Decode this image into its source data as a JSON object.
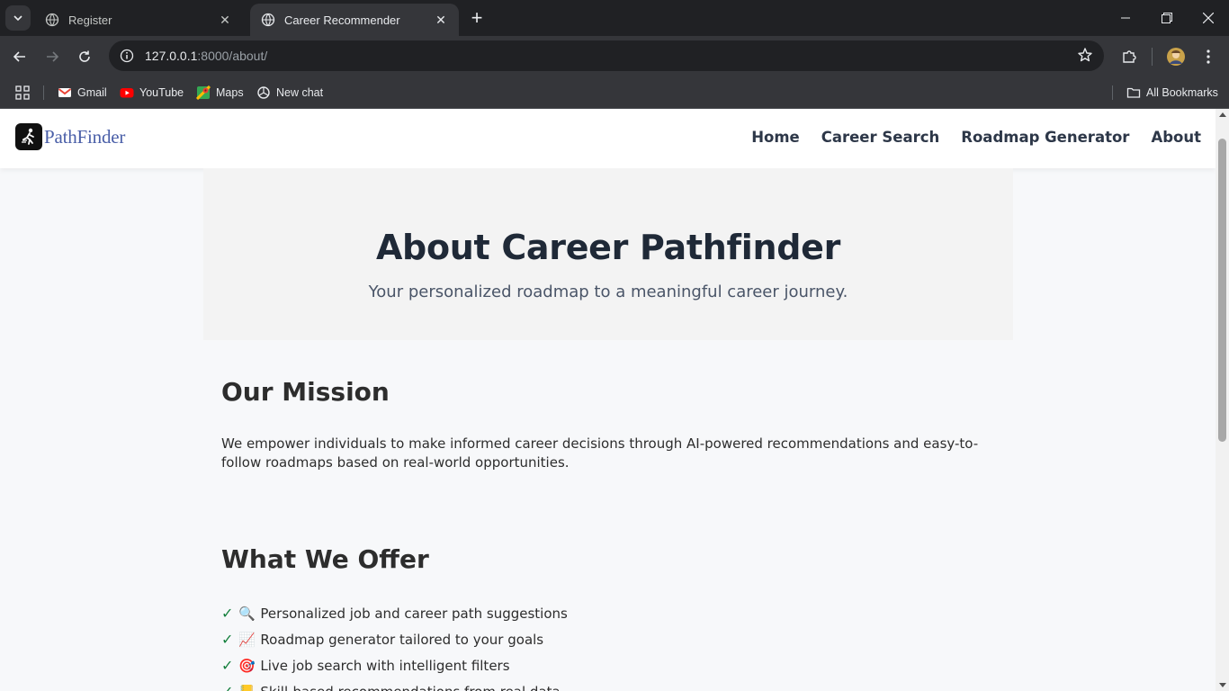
{
  "browser": {
    "tabs": [
      {
        "title": "Register",
        "active": false
      },
      {
        "title": "Career Recommender",
        "active": true
      }
    ],
    "url_host": "127.0.0.1",
    "url_path": ":8000/about/",
    "bookmarks": [
      {
        "label": "Gmail",
        "icon": "gmail-icon"
      },
      {
        "label": "YouTube",
        "icon": "youtube-icon"
      },
      {
        "label": "Maps",
        "icon": "maps-icon"
      },
      {
        "label": "New chat",
        "icon": "chatgpt-icon"
      }
    ],
    "all_bookmarks_label": "All Bookmarks"
  },
  "site": {
    "logo_text": "PathFinder",
    "nav": [
      "Home",
      "Career Search",
      "Roadmap Generator",
      "About"
    ]
  },
  "hero": {
    "title": "About Career Pathfinder",
    "subtitle": "Your personalized roadmap to a meaningful career journey."
  },
  "mission": {
    "title": "Our Mission",
    "text": "We empower individuals to make informed career decisions through AI-powered recommendations and easy-to-follow roadmaps based on real-world opportunities."
  },
  "offer": {
    "title": "What We Offer",
    "items": [
      {
        "check": "✓",
        "emoji": "🔍",
        "text": "Personalized job and career path suggestions"
      },
      {
        "check": "✓",
        "emoji": "📈",
        "text": "Roadmap generator tailored to your goals"
      },
      {
        "check": "✓",
        "emoji": "🎯",
        "text": "Live job search with intelligent filters"
      },
      {
        "check": "✓",
        "emoji": "📒",
        "text": "Skill-based recommendations from real data"
      }
    ]
  },
  "colors": {
    "nav_text": "#2d3748",
    "hero_bg": "#f3f3f3",
    "check_green": "#15803d",
    "logo_blue": "#4a5fa8"
  }
}
